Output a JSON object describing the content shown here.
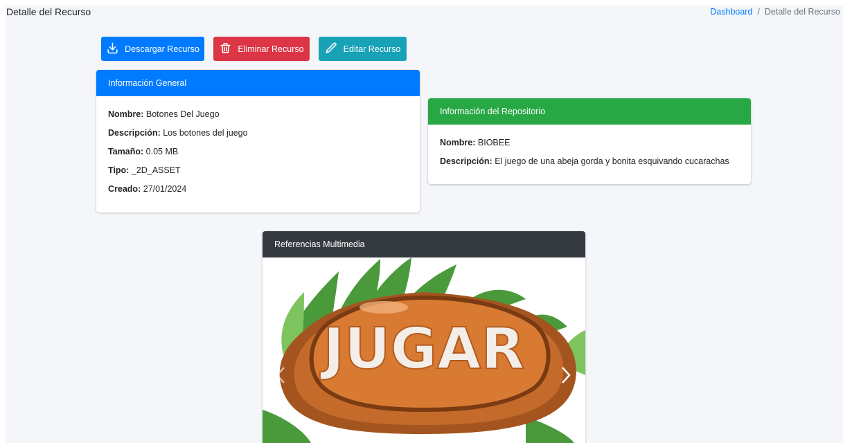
{
  "header": {
    "page_title": "Detalle del Recurso",
    "breadcrumb": {
      "home": "Dashboard",
      "separator": "/",
      "current": "Detalle del Recurso"
    }
  },
  "toolbar": {
    "download_label": "Descargar Recurso",
    "delete_label": "Eliminar Recurso",
    "edit_label": "Editar Recurso"
  },
  "general_info": {
    "title": "Información General",
    "fields": [
      {
        "label": "Nombre:",
        "value": "Botones Del Juego"
      },
      {
        "label": "Descripción:",
        "value": "Los botones del juego"
      },
      {
        "label": "Tamaño:",
        "value": "0.05 MB"
      },
      {
        "label": "Tipo:",
        "value": "_2D_ASSET"
      },
      {
        "label": "Creado:",
        "value": "27/01/2024"
      }
    ]
  },
  "repository_info": {
    "title": "Información del Repositorio",
    "fields": [
      {
        "label": "Nombre:",
        "value": "BIOBEE"
      },
      {
        "label": "Descripción:",
        "value": "El juego de una abeja gorda y bonita esquivando cucarachas"
      }
    ]
  },
  "multimedia": {
    "title": "Referencias Multimedia",
    "image_text": "JUGAR"
  },
  "icons": {
    "download": "download-icon",
    "delete": "trash-icon",
    "edit": "pencil-icon",
    "prev": "chevron-left-icon",
    "next": "chevron-right-icon"
  },
  "colors": {
    "primary": "#007bff",
    "danger": "#dc3545",
    "info": "#17a2b8",
    "success": "#28a745",
    "dark": "#343a40",
    "background": "#f4f6f9"
  }
}
